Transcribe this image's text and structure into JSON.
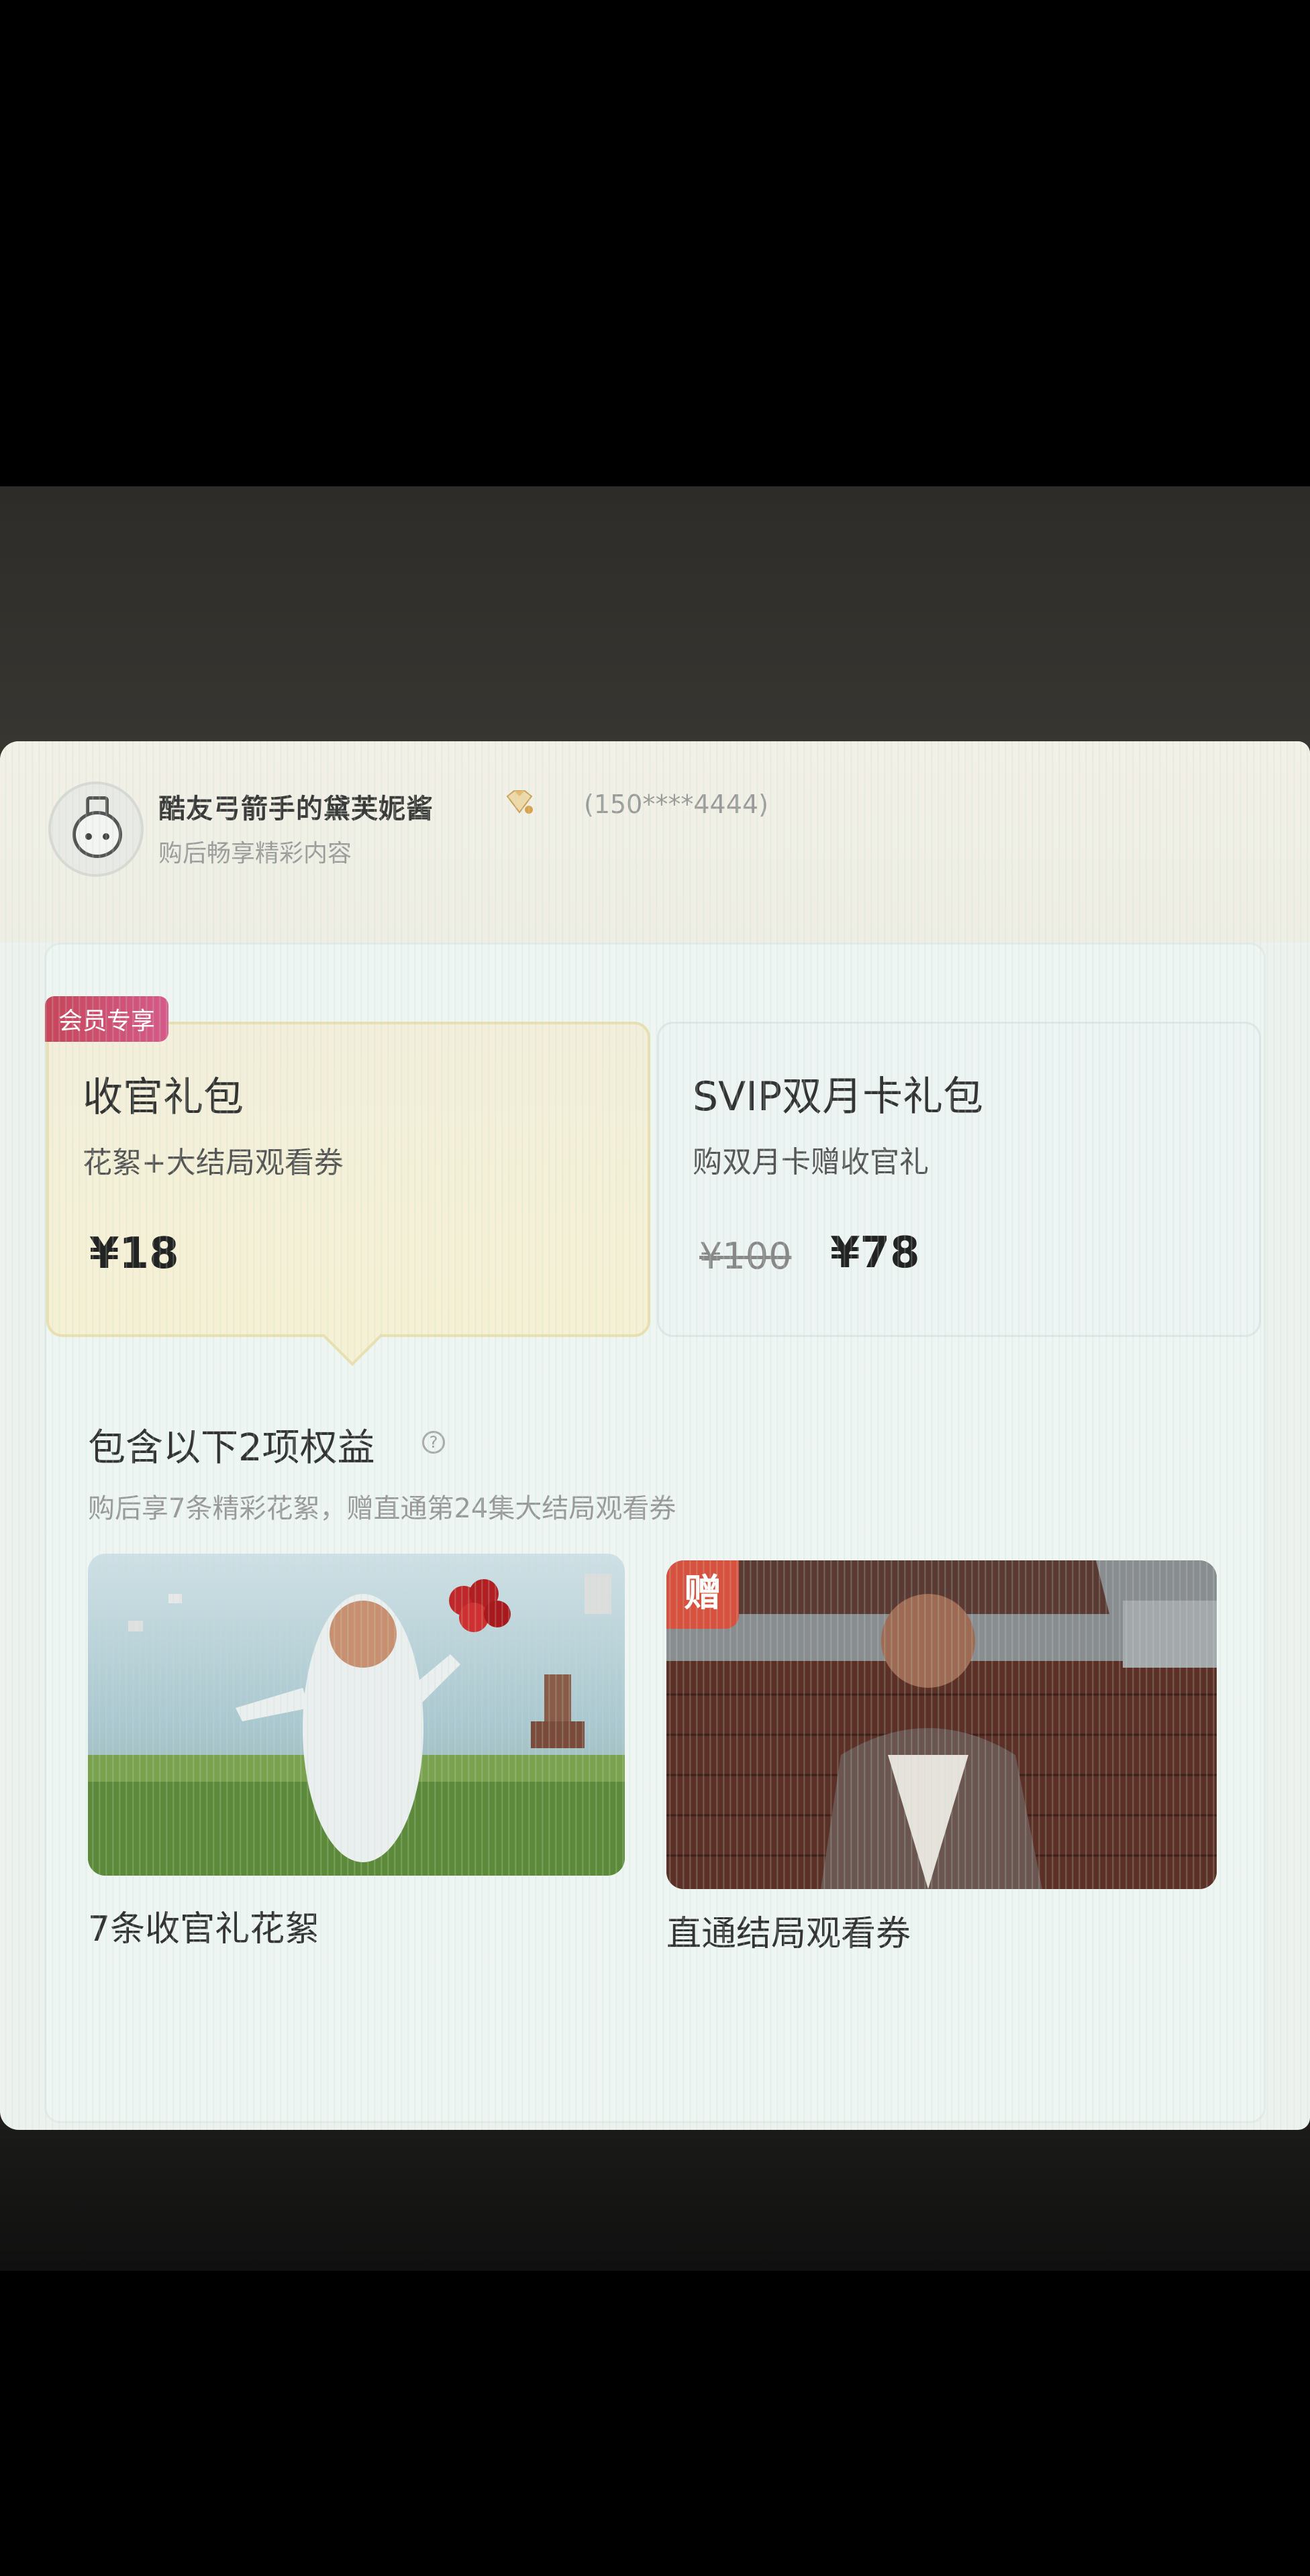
{
  "header": {
    "username": "酷友弓箭手的黛芙妮酱",
    "phone": "(150****4444)",
    "subtitle": "购后畅享精彩内容"
  },
  "cards": [
    {
      "badge": "会员专享",
      "title": "收官礼包",
      "desc": "花絮+大结局观看券",
      "price": "¥18"
    },
    {
      "title": "SVIP双月卡礼包",
      "desc": "购双月卡赠收官礼",
      "old_price": "¥100",
      "price": "¥78"
    }
  ],
  "benefits": {
    "title": "包含以下2项权益",
    "help_glyph": "?",
    "desc": "购后享7条精彩花絮，赠直通第24集大结局观看券",
    "items": [
      {
        "caption": "7条收官礼花絮"
      },
      {
        "badge": "赠",
        "caption": "直通结局观看券"
      }
    ]
  },
  "colors": {
    "badge_gradient": [
      "#c7455a",
      "#d65a8a"
    ],
    "gift_badge": "#d8503e",
    "selected_card_bg": "#f6f0d4"
  },
  "icons": [
    "avatar-icon",
    "vip-diamond-icon",
    "help-icon"
  ]
}
